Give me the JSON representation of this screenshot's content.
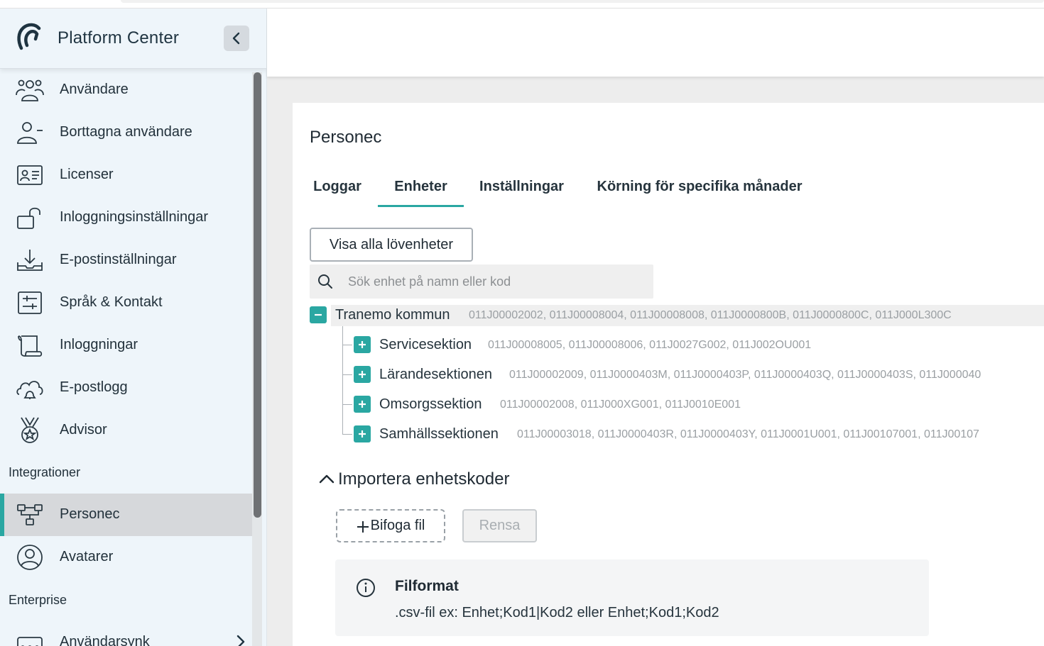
{
  "app": {
    "title": "Platform Center"
  },
  "sidebar": {
    "items": [
      {
        "label": "Användare",
        "icon": "users-icon"
      },
      {
        "label": "Borttagna användare",
        "icon": "user-minus-icon"
      },
      {
        "label": "Licenser",
        "icon": "id-card-icon"
      },
      {
        "label": "Inloggningsinställningar",
        "icon": "unlock-icon"
      },
      {
        "label": "E-postinställningar",
        "icon": "download-tray-icon"
      },
      {
        "label": "Språk & Kontakt",
        "icon": "sliders-icon"
      },
      {
        "label": "Inloggningar",
        "icon": "scroll-icon"
      },
      {
        "label": "E-postlogg",
        "icon": "cloud-bell-icon"
      },
      {
        "label": "Advisor",
        "icon": "medal-icon"
      }
    ],
    "sections": {
      "integrations": "Integrationer",
      "enterprise": "Enterprise"
    },
    "integration_items": [
      {
        "label": "Personec",
        "icon": "network-icon",
        "active": true
      },
      {
        "label": "Avatarer",
        "icon": "user-circle-icon"
      }
    ],
    "enterprise_items": [
      {
        "label": "Användarsynk",
        "icon": "sync-icon"
      }
    ]
  },
  "main": {
    "title": "Personec",
    "tabs": [
      {
        "label": "Loggar"
      },
      {
        "label": "Enheter",
        "active": true
      },
      {
        "label": "Inställningar"
      },
      {
        "label": "Körning för specifika månader"
      }
    ],
    "show_leaf_button": "Visa alla lövenheter",
    "search": {
      "placeholder": "Sök enhet på namn eller kod"
    },
    "tree": {
      "root": {
        "name": "Tranemo kommun",
        "codes": "011J00002002, 011J00008004, 011J00008008, 011J0000800B, 011J0000800C, 011J000L300C",
        "expanded": true
      },
      "children": [
        {
          "name": "Servicesektion",
          "codes": "011J00008005, 011J00008006, 011J0027G002, 011J002OU001"
        },
        {
          "name": "Lärandesektionen",
          "codes": "011J00002009, 011J0000403M, 011J0000403P, 011J0000403Q, 011J0000403S, 011J000040"
        },
        {
          "name": "Omsorgssektion",
          "codes": "011J00002008, 011J000XG001, 011J0010E001"
        },
        {
          "name": "Samhällssektionen",
          "codes": "011J00003018, 011J0000403R, 011J0000403Y, 011J0001U001, 011J00107001, 011J00107"
        }
      ]
    },
    "import": {
      "title": "Importera enhetskoder",
      "attach_label": "Bifoga fil",
      "clear_label": "Rensa",
      "info_title": "Filformat",
      "info_text": ".csv-fil ex: Enhet;Kod1|Kod2 eller Enhet;Kod1;Kod2"
    }
  },
  "colors": {
    "accent": "#2aa7a2",
    "sidebar_bg": "#eef5fa",
    "active_item_bg": "#d6d8db"
  }
}
